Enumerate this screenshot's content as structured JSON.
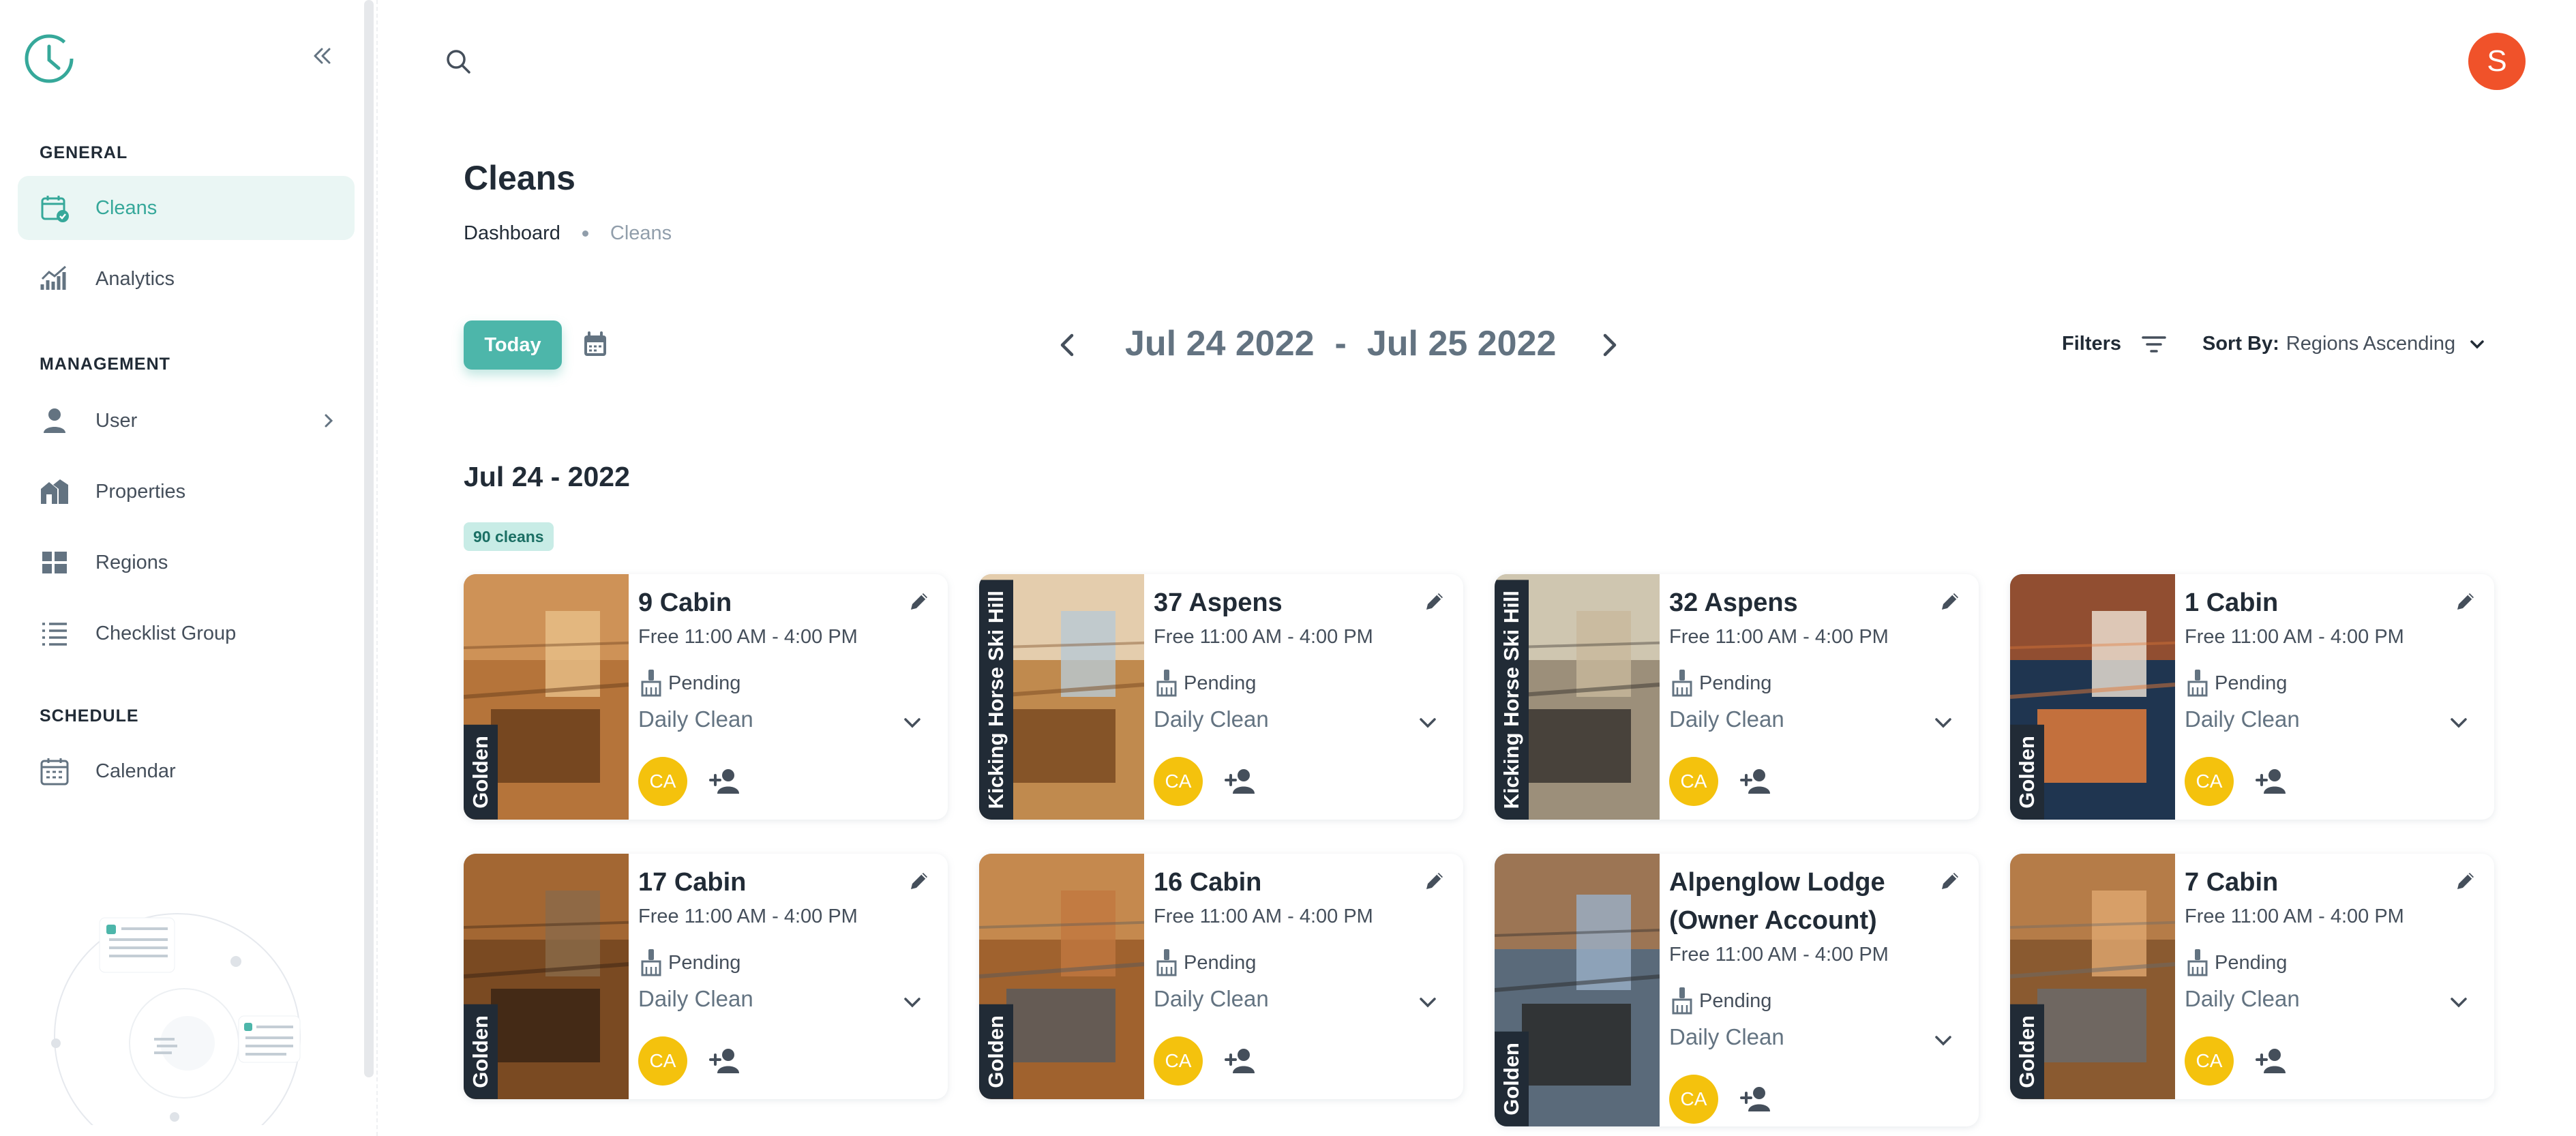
{
  "sidebar": {
    "sections": {
      "general": "GENERAL",
      "management": "MANAGEMENT",
      "schedule": "SCHEDULE"
    },
    "items": [
      {
        "label": "Cleans"
      },
      {
        "label": "Analytics"
      },
      {
        "label": "User"
      },
      {
        "label": "Properties"
      },
      {
        "label": "Regions"
      },
      {
        "label": "Checklist Group"
      },
      {
        "label": "Calendar"
      }
    ]
  },
  "header": {
    "avatar_initial": "S"
  },
  "page": {
    "title": "Cleans",
    "breadcrumb": [
      "Dashboard",
      "Cleans"
    ]
  },
  "controls": {
    "today_label": "Today",
    "date_from": "Jul 24 2022",
    "date_sep": "-",
    "date_to": "Jul 25 2022",
    "filters_label": "Filters",
    "sort_key": "Sort By:",
    "sort_value": "Regions Ascending"
  },
  "day": {
    "title": "Jul 24 - 2022",
    "count": "90 cleans"
  },
  "cards": [
    {
      "region": "Golden",
      "title": "9 Cabin",
      "time": "Free 11:00 AM - 4:00 PM",
      "status": "Pending",
      "clean_type": "Daily Clean",
      "assignee": "CA"
    },
    {
      "region": "Kicking Horse Ski Hill",
      "title": "37 Aspens",
      "time": "Free 11:00 AM - 4:00 PM",
      "status": "Pending",
      "clean_type": "Daily Clean",
      "assignee": "CA"
    },
    {
      "region": "Kicking Horse Ski Hill",
      "title": "32 Aspens",
      "time": "Free 11:00 AM - 4:00 PM",
      "status": "Pending",
      "clean_type": "Daily Clean",
      "assignee": "CA"
    },
    {
      "region": "Golden",
      "title": "1 Cabin",
      "time": "Free 11:00 AM - 4:00 PM",
      "status": "Pending",
      "clean_type": "Daily Clean",
      "assignee": "CA"
    },
    {
      "region": "Golden",
      "title": "17 Cabin",
      "time": "Free 11:00 AM - 4:00 PM",
      "status": "Pending",
      "clean_type": "Daily Clean",
      "assignee": "CA"
    },
    {
      "region": "Golden",
      "title": "16 Cabin",
      "time": "Free 11:00 AM - 4:00 PM",
      "status": "Pending",
      "clean_type": "Daily Clean",
      "assignee": "CA"
    },
    {
      "region": "Golden",
      "title": "Alpenglow Lodge (Owner Account)",
      "time": "Free 11:00 AM - 4:00 PM",
      "status": "Pending",
      "clean_type": "Daily Clean",
      "assignee": "CA"
    },
    {
      "region": "Golden",
      "title": "7 Cabin",
      "time": "Free 11:00 AM - 4:00 PM",
      "status": "Pending",
      "clean_type": "Daily Clean",
      "assignee": "CA"
    }
  ],
  "colors": {
    "accent": "#4db6aa",
    "avatar": "#f0522a",
    "assignee": "#f4c20d"
  }
}
